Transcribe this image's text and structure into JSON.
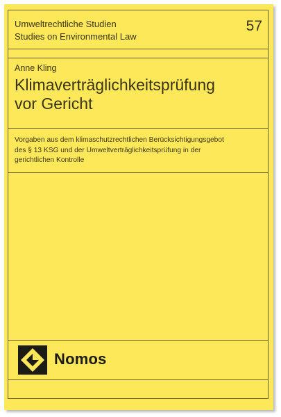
{
  "series": {
    "title_de": "Umweltrechtliche Studien",
    "title_en": "Studies on Environmental Law",
    "volume": "57"
  },
  "book": {
    "author": "Anne Kling",
    "title_line1": "Klimaverträglichkeitsprüfung",
    "title_line2": "vor Gericht",
    "subtitle_line1": "Vorgaben aus dem klimaschutzrechtlichen Berücksichtigungsgebot",
    "subtitle_line2": "des § 13 KSG und der Umweltverträglichkeitsprüfung in der",
    "subtitle_line3": "gerichtlichen Kontrolle"
  },
  "publisher": {
    "name": "Nomos",
    "logo_icon": "nomos-diamond-logo-icon"
  },
  "colors": {
    "cover_background": "#fde85a",
    "text": "#3b3414",
    "rule_lines": "#6b5e1a"
  }
}
